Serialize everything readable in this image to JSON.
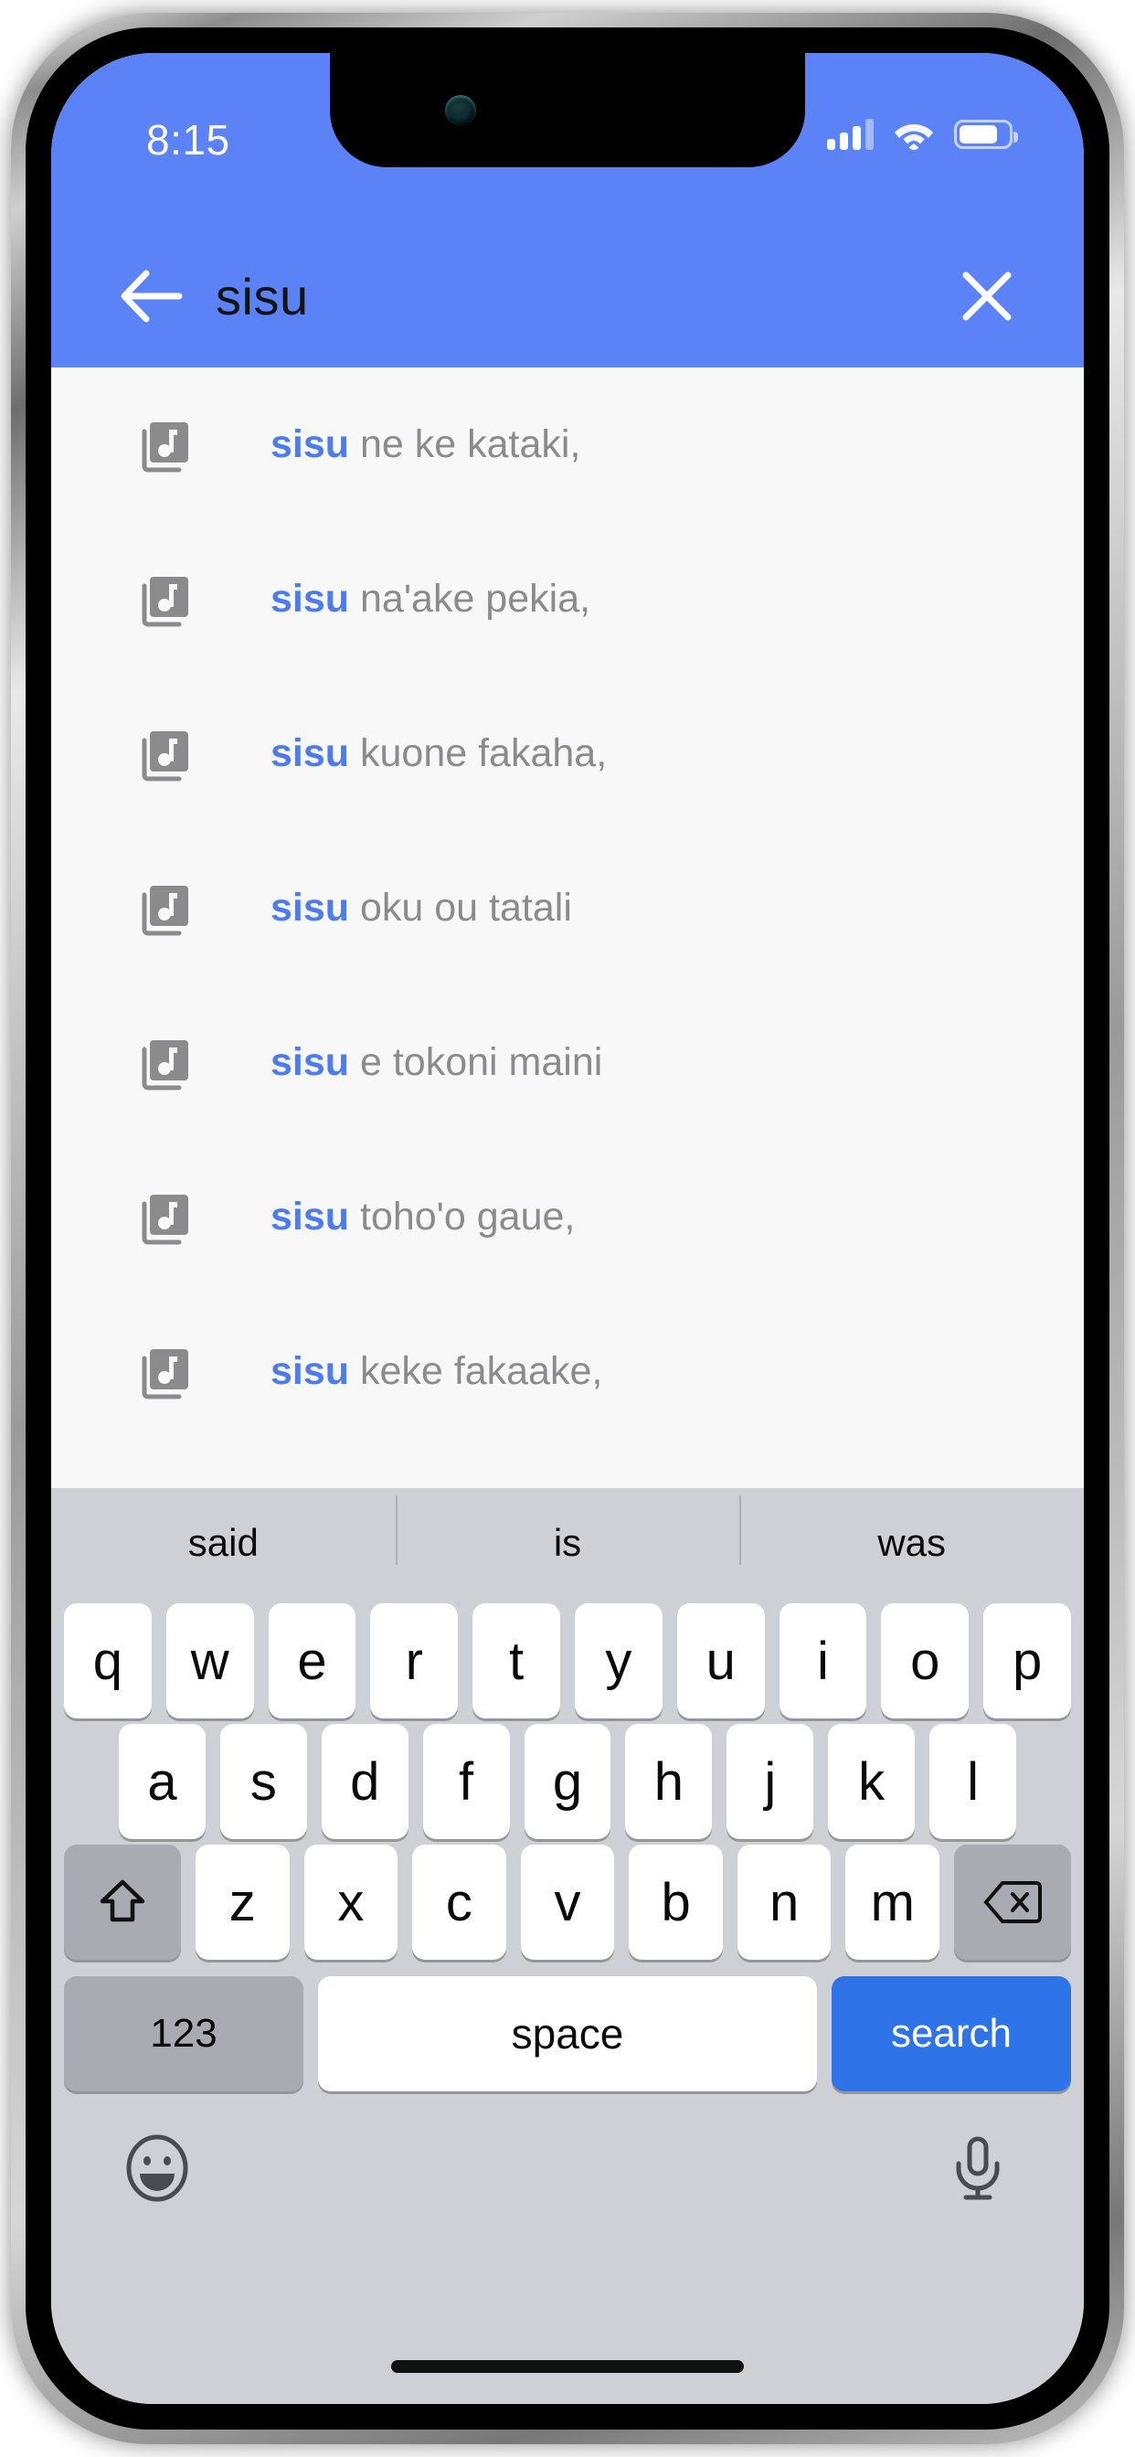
{
  "theme": {
    "brand_blue": "#5b82f6",
    "accent_blue": "#4d7cf0",
    "search_key_blue": "#2f73e8",
    "keyboard_bg": "#cfcfd6",
    "result_text_gray": "#8b8b8e"
  },
  "status_bar": {
    "time": "8:15",
    "cellular_icon": "signal-bars-icon",
    "cellular_bars_filled": 3,
    "cellular_bars_total": 4,
    "wifi_icon": "wifi-icon",
    "battery_icon": "battery-icon",
    "battery_level_percent": 78
  },
  "app_bar": {
    "back_icon": "arrow-left-icon",
    "query": "sisu",
    "close_icon": "close-icon"
  },
  "results": {
    "item_icon": "library-music-icon",
    "items": [
      {
        "match": "sisu",
        "rest": " ne ke kataki,"
      },
      {
        "match": "sisu",
        "rest": " na'ake pekia,"
      },
      {
        "match": "sisu",
        "rest": " kuone fakaha,"
      },
      {
        "match": "sisu",
        "rest": " oku ou tatali"
      },
      {
        "match": "sisu",
        "rest": " e tokoni maini"
      },
      {
        "match": "sisu",
        "rest": " toho'o gaue,"
      },
      {
        "match": "sisu",
        "rest": " keke fakaake,"
      }
    ]
  },
  "keyboard": {
    "suggestions": [
      "said",
      "is",
      "was"
    ],
    "row1": [
      "q",
      "w",
      "e",
      "r",
      "t",
      "y",
      "u",
      "i",
      "o",
      "p"
    ],
    "row2": [
      "a",
      "s",
      "d",
      "f",
      "g",
      "h",
      "j",
      "k",
      "l"
    ],
    "row3": [
      "z",
      "x",
      "c",
      "v",
      "b",
      "n",
      "m"
    ],
    "shift_icon": "shift-arrow-up-icon",
    "backspace_icon": "backspace-delete-icon",
    "numbers_key": "123",
    "space_key": "space",
    "return_key": "search",
    "emoji_icon": "emoji-smiley-icon",
    "mic_icon": "microphone-icon"
  }
}
